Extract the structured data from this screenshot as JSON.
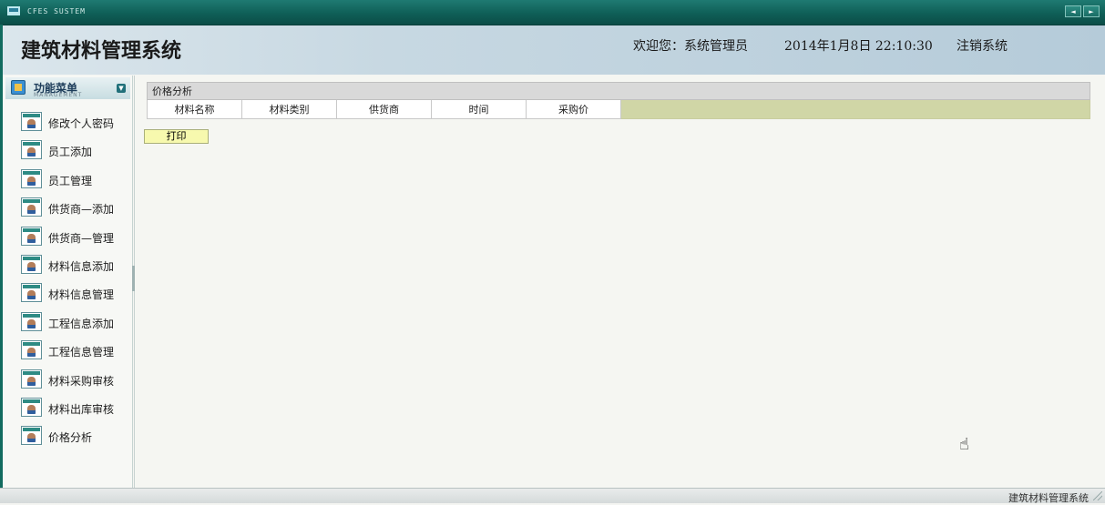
{
  "window": {
    "title": "CFES SUSTEM",
    "nav_prev": "◄",
    "nav_next": "►"
  },
  "header": {
    "system_title": "建筑材料管理系统",
    "welcome": "欢迎您：系统管理员",
    "datetime": "2014年1月8日  22:10:30",
    "logout": "注销系统"
  },
  "sidebar": {
    "menu_title": "功能菜单",
    "menu_subtitle": "MANAGEMENT",
    "items": [
      {
        "label": "修改个人密码"
      },
      {
        "label": "员工添加"
      },
      {
        "label": "员工管理"
      },
      {
        "label": "供货商—添加"
      },
      {
        "label": "供货商—管理"
      },
      {
        "label": "材料信息添加"
      },
      {
        "label": "材料信息管理"
      },
      {
        "label": "工程信息添加"
      },
      {
        "label": "工程信息管理"
      },
      {
        "label": "材料采购审核"
      },
      {
        "label": "材料出库审核"
      },
      {
        "label": "价格分析"
      }
    ]
  },
  "main": {
    "table_caption": "价格分析",
    "columns": [
      "材料名称",
      "材料类别",
      "供货商",
      "时间",
      "采购价"
    ],
    "print_button": "打印"
  },
  "footer": {
    "text": "建筑材料管理系统"
  }
}
